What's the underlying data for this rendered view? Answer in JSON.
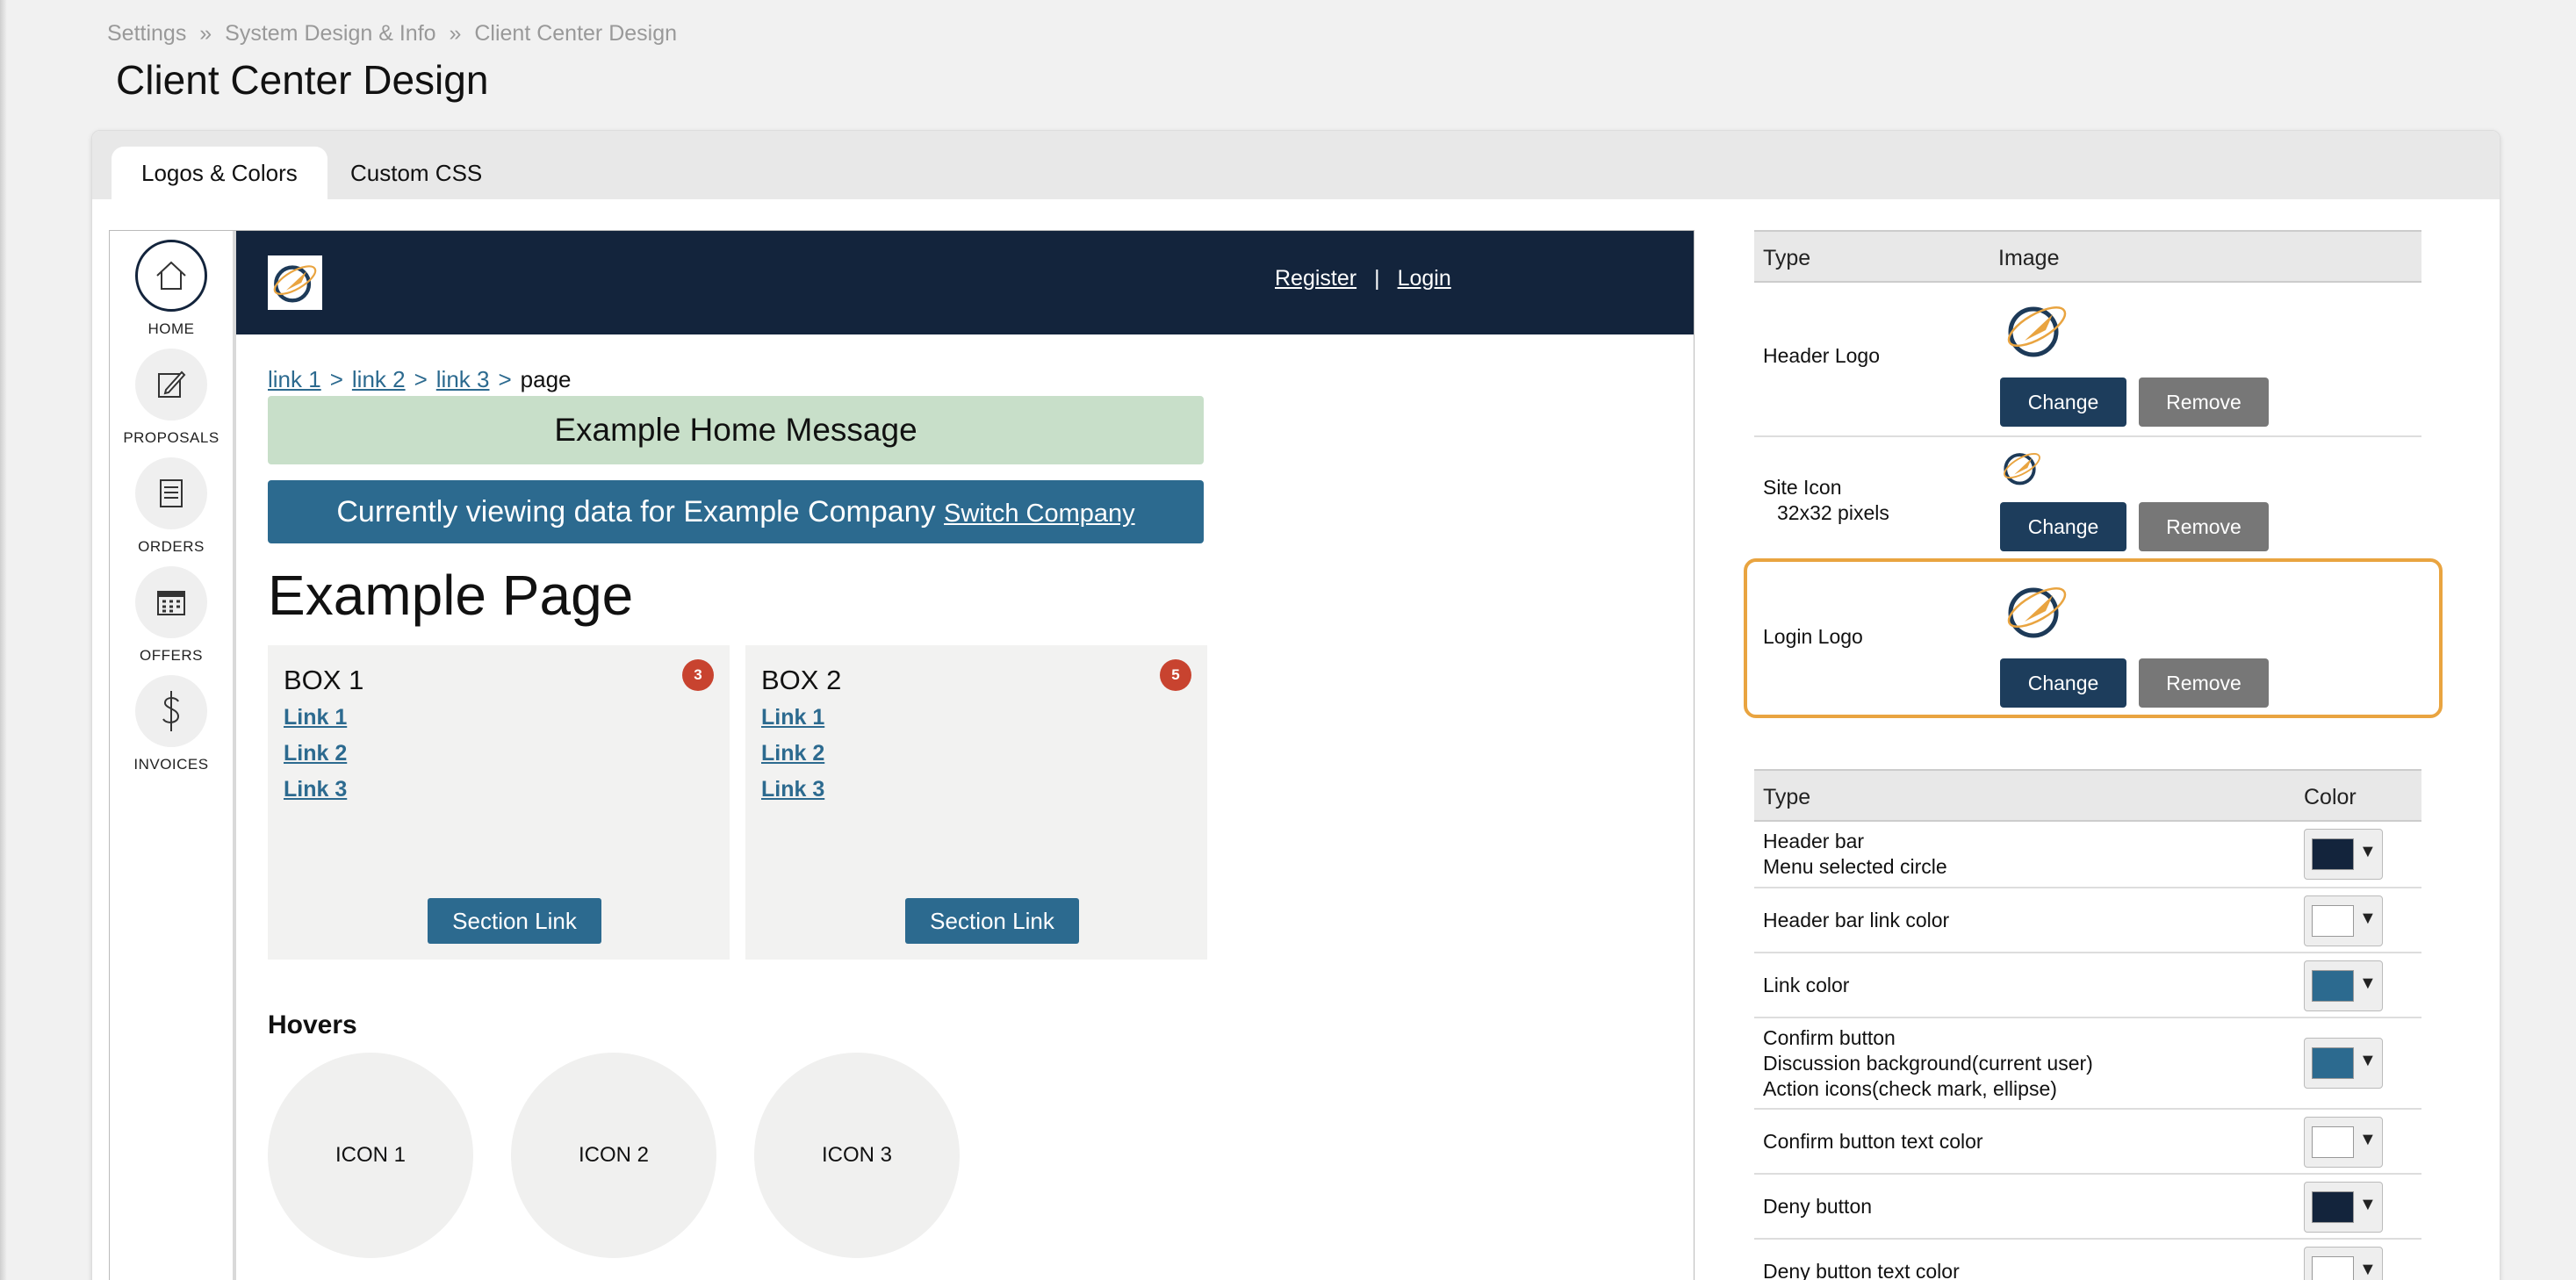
{
  "breadcrumb": {
    "items": [
      "Settings",
      "»",
      "System Design & Info",
      "»",
      "Client Center Design"
    ]
  },
  "page": {
    "title": "Client Center Design"
  },
  "tabs": {
    "active": "Logos & Colors",
    "other": "Custom CSS"
  },
  "preview": {
    "nav": [
      {
        "label": "HOME",
        "icon": "home-icon"
      },
      {
        "label": "PROPOSALS",
        "icon": "edit-icon"
      },
      {
        "label": "ORDERS",
        "icon": "document-icon"
      },
      {
        "label": "OFFERS",
        "icon": "calendar-icon"
      },
      {
        "label": "INVOICES",
        "icon": "dollar-icon"
      }
    ],
    "header": {
      "register": "Register",
      "sep": "|",
      "login": "Login"
    },
    "crumbs": {
      "l1": "link 1",
      "l2": "link 2",
      "l3": "link 3",
      "gt": ">",
      "current": "page"
    },
    "home_message": "Example Home Message",
    "company_bar": {
      "text": "Currently viewing data for Example Company",
      "link": "Switch Company"
    },
    "title": "Example Page",
    "boxes": [
      {
        "title": "BOX 1",
        "badge": "3",
        "links": [
          "Link 1",
          "Link 2",
          "Link 3"
        ],
        "button": "Section Link"
      },
      {
        "title": "BOX 2",
        "badge": "5",
        "links": [
          "Link 1",
          "Link 2",
          "Link 3"
        ],
        "button": "Section Link"
      }
    ],
    "hovers": {
      "title": "Hovers",
      "icons": [
        "ICON 1",
        "ICON 2",
        "ICON 3"
      ]
    }
  },
  "logos": {
    "headers": {
      "type": "Type",
      "image": "Image"
    },
    "rows": [
      {
        "label": "Header Logo"
      },
      {
        "label": "Site Icon",
        "sub": "32x32 pixels"
      },
      {
        "label": "Login Logo"
      }
    ],
    "change": "Change",
    "remove": "Remove"
  },
  "colors": {
    "headers": {
      "type": "Type",
      "color": "Color"
    },
    "rows": [
      {
        "lines": [
          "Header bar",
          "Menu selected circle"
        ],
        "color": "#13243c"
      },
      {
        "lines": [
          "Header bar link color"
        ],
        "color": "#ffffff"
      },
      {
        "lines": [
          "Link color"
        ],
        "color": "#2c6a8f"
      },
      {
        "lines": [
          "Confirm button",
          "Discussion background(current user)",
          "Action icons(check mark, ellipse)"
        ],
        "color": "#2c6a8f"
      },
      {
        "lines": [
          "Confirm button text color"
        ],
        "color": "#ffffff"
      },
      {
        "lines": [
          "Deny button"
        ],
        "color": "#13243c"
      },
      {
        "lines": [
          "Deny button text color"
        ],
        "color": "#ffffff"
      }
    ],
    "arrow": "▼"
  }
}
